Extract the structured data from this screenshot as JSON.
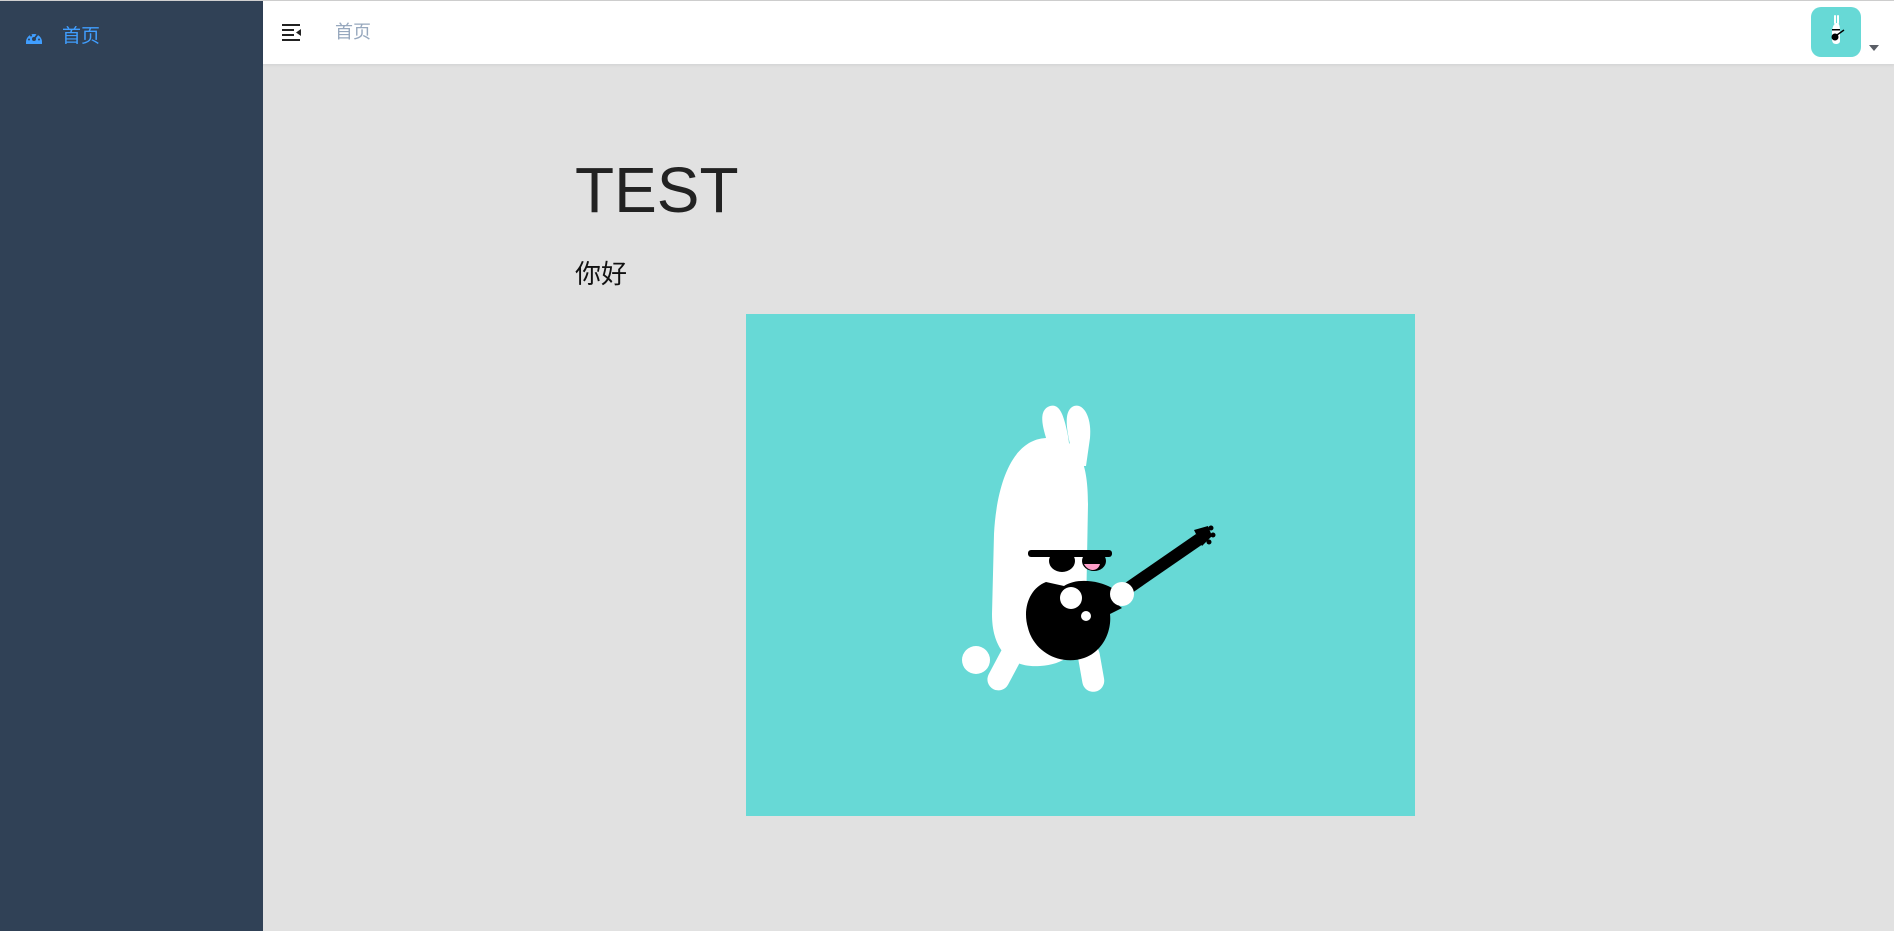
{
  "sidebar": {
    "items": [
      {
        "label": "首页",
        "icon": "dashboard-icon",
        "active": true
      }
    ]
  },
  "navbar": {
    "breadcrumb": [
      "首页"
    ],
    "hamburger_icon": "hamburger-icon",
    "avatar_icon": "rabbit-guitar-avatar",
    "dropdown_icon": "caret-down-icon"
  },
  "content": {
    "title": "TEST",
    "greeting": "你好",
    "image_icon": "rabbit-guitar-illustration"
  },
  "colors": {
    "sidebar_bg": "#304156",
    "active_menu": "#409eff",
    "page_bg": "#e1e1e1",
    "image_bg": "#67d9d6"
  }
}
